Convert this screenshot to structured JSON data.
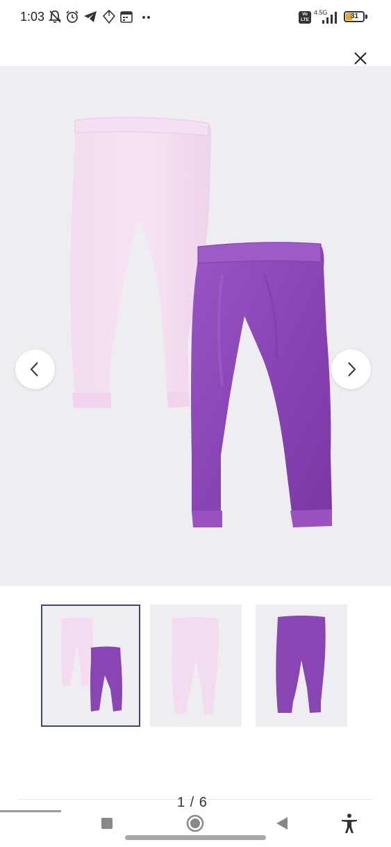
{
  "status": {
    "time": "1:03",
    "network": "4.5G",
    "volte_label": "Vo LTE",
    "battery": "31"
  },
  "gallery": {
    "counter": "1 / 6",
    "current": 1,
    "total": 6
  },
  "colors": {
    "light_pants": "#f2d9ee",
    "purple_pants": "#8a45b5",
    "background": "#eeedf1",
    "active_border": "#3b4a6b"
  },
  "thumbnails": [
    {
      "subject": "two pairs of pants",
      "active": true
    },
    {
      "subject": "light pink pants",
      "active": false
    },
    {
      "subject": "purple velvet pants",
      "active": false
    }
  ],
  "icons": {
    "close": "close-icon",
    "prev": "chevron-left-icon",
    "next": "chevron-right-icon"
  }
}
